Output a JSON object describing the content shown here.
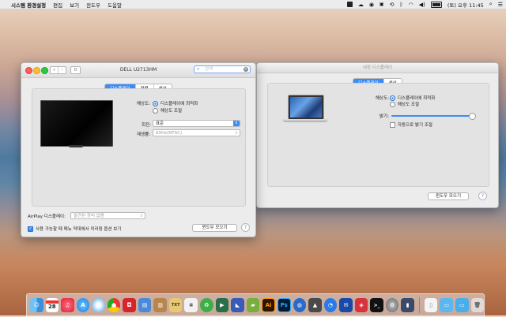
{
  "menubar": {
    "apple": "",
    "app_name": "시스템 환경설정",
    "menus": [
      "편집",
      "보기",
      "윈도우",
      "도움말"
    ],
    "clock": "(토) 오후 11:45",
    "battery_percent": 100
  },
  "window_left": {
    "title": "DELL U2713HM",
    "search_placeholder": "검색",
    "tabs": [
      "디스플레이",
      "정렬",
      "색상"
    ],
    "selected_tab": 0,
    "resolution_label": "해상도:",
    "resolution_option_1": "디스플레이에 최적화",
    "resolution_option_2": "해상도 조절",
    "rotation_label": "회전:",
    "rotation_value": "표준",
    "refresh_label": "재생률:",
    "refresh_value": "60Hz(NTSC)",
    "airplay_label": "AirPlay 디스플레이:",
    "airplay_value": "발견된 장비 없음",
    "mirror_checkbox_label": "사용 가능할 때 메뉴 막대에서 미러링 옵션 보기",
    "gather_button": "윈도우 모으기",
    "help": "?"
  },
  "window_right": {
    "title": "내장 디스플레이",
    "tabs": [
      "디스플레이",
      "색상"
    ],
    "selected_tab": 0,
    "resolution_label": "해상도:",
    "resolution_option_1": "디스플레이에 최적화",
    "resolution_option_2": "해상도 조절",
    "brightness_label": "밝기:",
    "brightness_level": 0.96,
    "auto_brightness_label": "자동으로 밝기 조절",
    "gather_button": "윈도우 모으기",
    "help": "?"
  },
  "dock": {
    "calendar_day": "28",
    "ai_label": "Ai",
    "ps_label": "Ps"
  }
}
